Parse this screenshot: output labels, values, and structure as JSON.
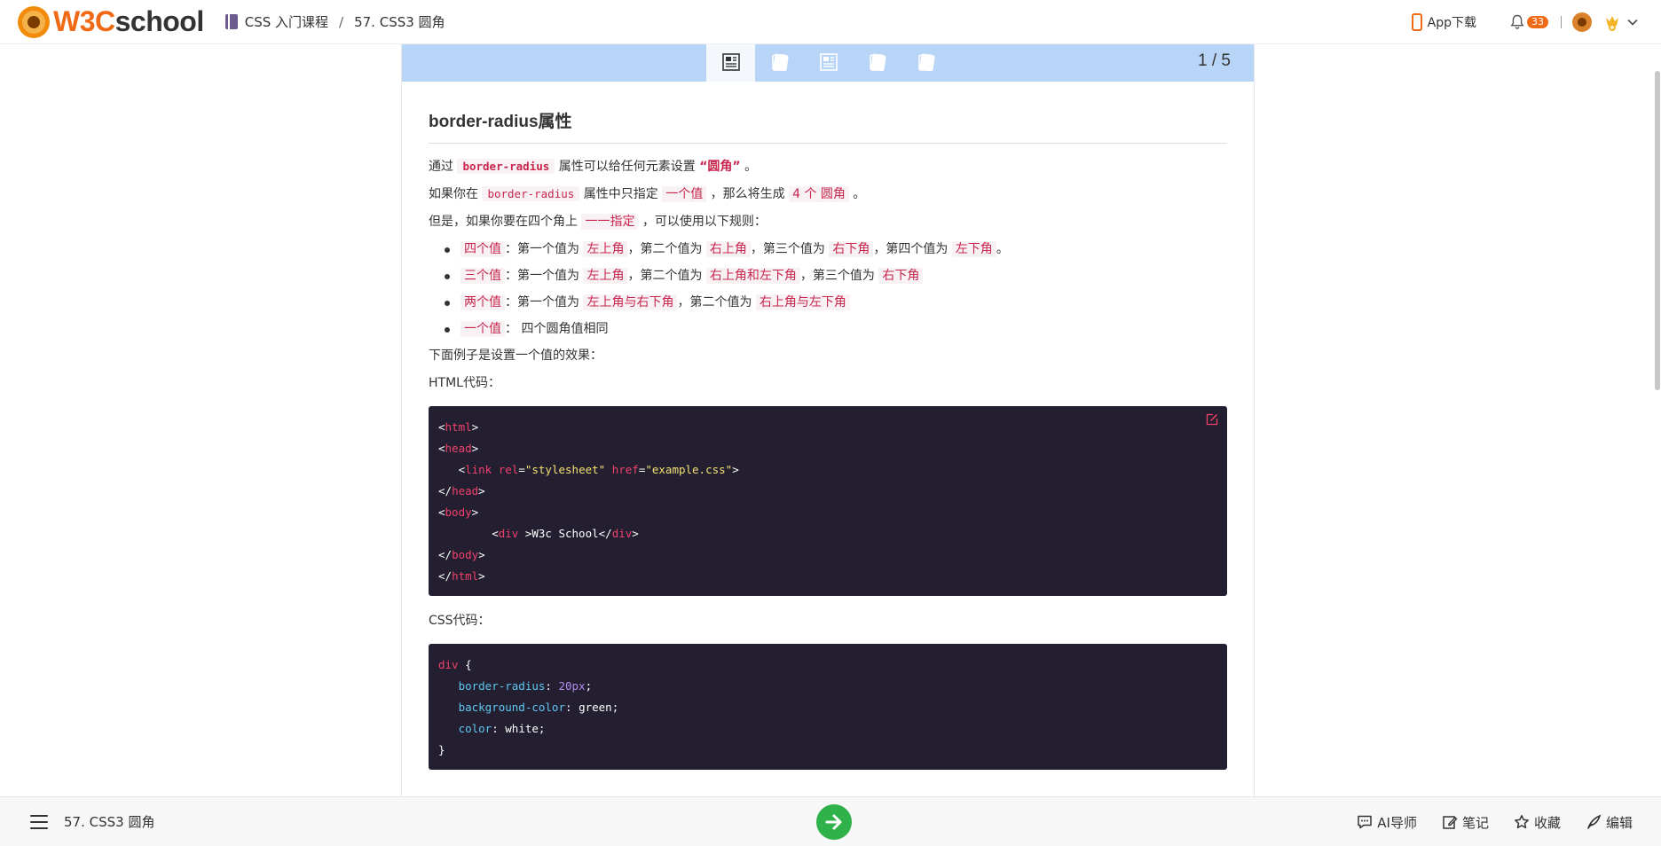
{
  "header": {
    "logo_w3c": "W3C",
    "logo_school": "school",
    "breadcrumb_course": "CSS 入门课程",
    "breadcrumb_sep": "/",
    "breadcrumb_lesson": "57. CSS3 圆角",
    "app_download": "App下载",
    "notification_count": "33",
    "icons": [
      "logo-icon",
      "book-icon",
      "phone-icon",
      "bell-icon",
      "avatar",
      "vip-crown-icon",
      "chevron-down-icon"
    ]
  },
  "stepbar": {
    "steps": [
      "article",
      "quiz",
      "article",
      "quiz",
      "quiz"
    ],
    "active_index": 0,
    "progress": "1 / 5"
  },
  "lesson": {
    "title": "border-radius属性",
    "p1": {
      "a": "通过",
      "code": "border-radius",
      "b": "属性可以给任何元素设置",
      "c": "“圆角”",
      "d": "。"
    },
    "p2": {
      "a": "如果你在",
      "code": "border-radius",
      "b": "属性中只指定",
      "c": "一个值",
      "d": "，那么将生成",
      "e": "4 个 圆角",
      "f": "。"
    },
    "p3": {
      "a": "但是，如果你要在四个角上",
      "b": "一一指定",
      "c": "，可以使用以下规则："
    },
    "rules": [
      {
        "k": "四个值",
        "t1": "：第一个值为",
        "v1": "左上角",
        "t2": "，第二个值为",
        "v2": "右上角",
        "t3": "，第三个值为",
        "v3": "右下角",
        "t4": "，第四个值为",
        "v4": "左下角",
        "t5": "。"
      },
      {
        "k": "三个值",
        "t1": "：第一个值为",
        "v1": "左上角",
        "t2": "，第二个值为",
        "v2": "右上角和左下角",
        "t3": "，第三个值为",
        "v3": "右下角"
      },
      {
        "k": "两个值",
        "t1": "：第一个值为",
        "v1": "左上角与右下角",
        "t2": "，第二个值为",
        "v2": "右上角与左下角"
      },
      {
        "k": "一个值",
        "t1": "： 四个圆角值相同"
      }
    ],
    "example_intro": "下面例子是设置一个值的效果：",
    "html_label": "HTML代码：",
    "css_label": "CSS代码：",
    "html_code": {
      "l1_open": "<",
      "l1_tag": "html",
      "l1_close": ">",
      "l2_tag": "head",
      "l3_link": "link",
      "l3_rel": "rel",
      "l3_rel_val": "\"stylesheet\"",
      "l3_href": "href",
      "l3_href_val": "\"example.css\"",
      "l4_tag": "head",
      "l5_tag": "body",
      "l6_tag": "div",
      "l6_text": "W3c School",
      "l7_tag": "body",
      "l8_tag": "html"
    },
    "css_code": {
      "selector": "div",
      "decls": [
        {
          "prop": "border-radius",
          "val": "20px",
          "is_num": true
        },
        {
          "prop": "background-color",
          "val": "green",
          "is_num": false
        },
        {
          "prop": "color",
          "val": "white",
          "is_num": false
        }
      ]
    }
  },
  "bottom": {
    "lesson_title": "57. CSS3 圆角",
    "ai": "AI导师",
    "notes": "笔记",
    "favorite": "收藏",
    "edit": "编辑"
  },
  "colors": {
    "brand_orange": "#f06a16",
    "stepbar_blue": "#b8d4f7",
    "code_bg": "#231f30",
    "inline_code": "#c7254e",
    "next_green": "#2fb24a"
  }
}
